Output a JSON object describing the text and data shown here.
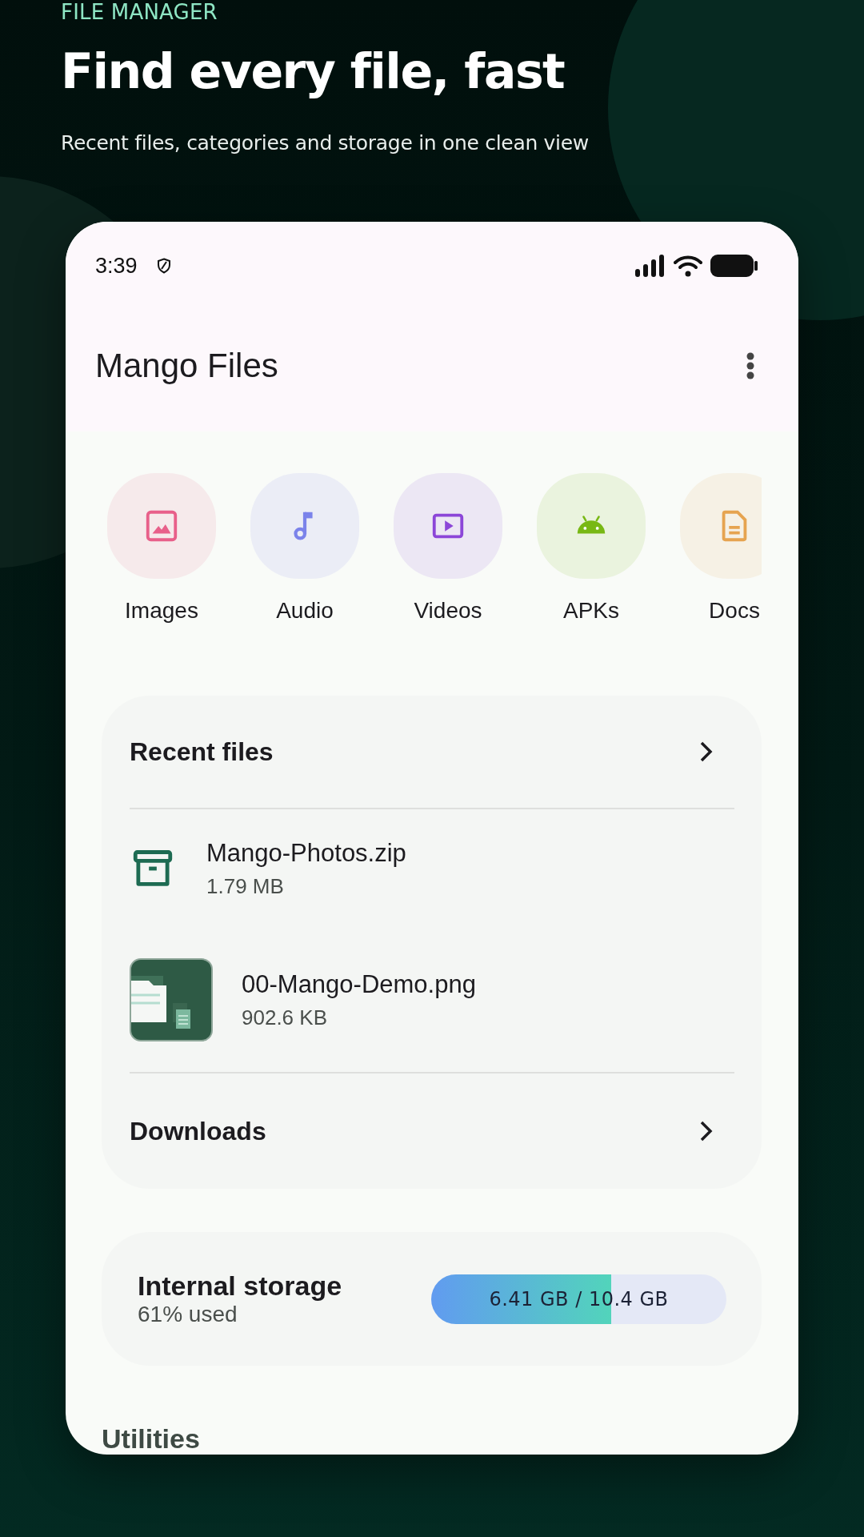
{
  "hero": {
    "eyebrow": "FILE MANAGER",
    "title": "Find every file, fast",
    "subtitle": "Recent files, categories and storage in one clean view"
  },
  "status_bar": {
    "time": "3:39"
  },
  "app_bar": {
    "title": "Mango Files"
  },
  "categories": [
    {
      "kind": "image",
      "label": "Images",
      "color": "#e8608a"
    },
    {
      "kind": "audio",
      "label": "Audio",
      "color": "#7b83ea"
    },
    {
      "kind": "video",
      "label": "Videos",
      "color": "#8c46d8"
    },
    {
      "kind": "android",
      "label": "APKs",
      "color": "#78b814"
    },
    {
      "kind": "doc",
      "label": "Docs",
      "color": "#e6a450"
    }
  ],
  "recent_card": {
    "title": "Recent files",
    "files": [
      {
        "kind": "archive",
        "name": "Mango-Photos.zip",
        "size": "1.79 MB"
      },
      {
        "kind": "thumbnail",
        "name": "00-Mango-Demo.png",
        "size": "902.6 KB"
      }
    ],
    "footer_link": "Downloads"
  },
  "storage": {
    "title": "Internal storage",
    "usage": "61% used",
    "level": 0.61,
    "reading": "6.41 GB / 10.4 GB"
  },
  "next_section": {
    "title": "Utilities"
  }
}
